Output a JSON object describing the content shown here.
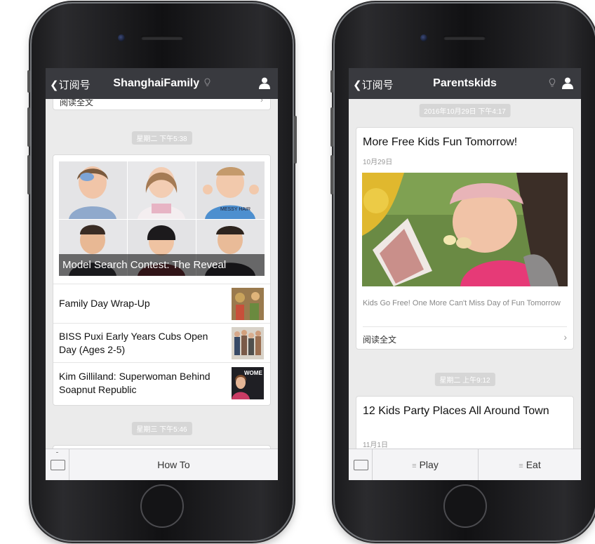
{
  "left_phone": {
    "nav": {
      "back_label": "订阅号",
      "title": "ShanghaiFamily"
    },
    "top_card": {
      "read_more": "阅读全文"
    },
    "timestamp_1": "星期二 下午5:38",
    "article_group": {
      "main_title": "Model Search Contest: The Reveal",
      "items": [
        {
          "title": "Family Day Wrap-Up"
        },
        {
          "title": "BISS Puxi Early Years Cubs Open Day (Ages 2-5)"
        },
        {
          "title": "Kim Gilliland: Superwoman Behind Soapnut Republic",
          "thumb_text": "WOME"
        }
      ]
    },
    "timestamp_2": "星期三 下午5:46",
    "bottom_menu": {
      "item_1": "How To"
    }
  },
  "right_phone": {
    "nav": {
      "back_label": "订阅号",
      "title": "Parentskids"
    },
    "timestamp_1": "2016年10月29日 下午4:17",
    "article_1": {
      "title": "More Free Kids Fun Tomorrow!",
      "date": "10月29日",
      "summary": "Kids Go Free! One More Can't Miss Day of Fun Tomorrow",
      "read_more": "阅读全文"
    },
    "timestamp_2": "星期二 上午9:12",
    "article_2": {
      "title": "12 Kids Party Places All Around Town",
      "date": "11月1日"
    },
    "bottom_menu": {
      "item_1": "Play",
      "item_2": "Eat"
    }
  },
  "colors": {
    "navbar": "#393a3f",
    "background": "#ebebeb",
    "card": "#ffffff"
  }
}
